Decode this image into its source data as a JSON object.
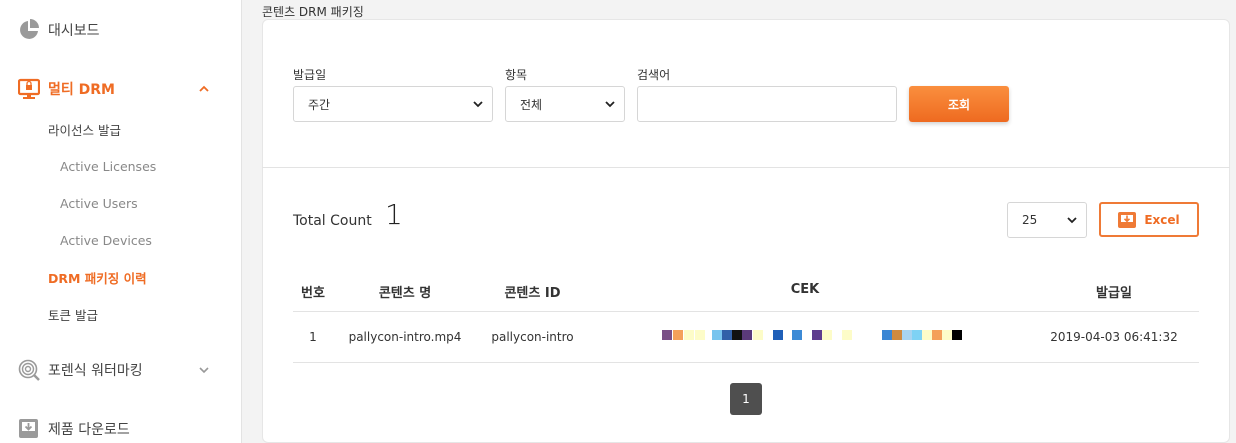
{
  "sidebar": {
    "dashboard": "대시보드",
    "multi_drm": "멀티 DRM",
    "license_issue": "라이선스 발급",
    "active_licenses": "Active Licenses",
    "active_users": "Active Users",
    "active_devices": "Active Devices",
    "drm_packaging_history": "DRM 패키징 이력",
    "token_issue": "토큰 발급",
    "forensic_watermark": "포렌식 워터마킹",
    "product_download": "제품 다운로드"
  },
  "page": {
    "title": "콘텐츠 DRM 패키징"
  },
  "filters": {
    "date_label": "발급일",
    "date_value": "주간",
    "item_label": "항목",
    "item_value": "전체",
    "search_label": "검색어",
    "search_value": "",
    "search_button": "조회"
  },
  "summary": {
    "total_label": "Total Count",
    "total_value": "1",
    "page_size": "25",
    "excel_button": "Excel"
  },
  "table": {
    "headers": [
      "번호",
      "콘텐츠 명",
      "콘텐츠 ID",
      "CEK",
      "발급일"
    ],
    "rows": [
      {
        "no": "1",
        "content_name": "pallycon-intro.mp4",
        "content_id": "pallycon-intro",
        "cek_colors": [
          "#7a4f86",
          "#f4a05a",
          "#fdfcc8",
          "#fdfcc8",
          "#78c4ee",
          "#3160a8",
          "#111111",
          "#5a3a7a",
          "#fdfcc8",
          "#1f5fb8",
          "#3c8ad6",
          "#5e3c8e",
          "#fdfcc8",
          "#fdfcc8",
          "#3a86d4",
          "#cf8a40",
          "#a8d4f0",
          "#7ed2f4",
          "#fdfcc8",
          "#f4a05a",
          "#fdfcc8",
          "#000000"
        ],
        "issued": "2019-04-03 06:41:32"
      }
    ]
  },
  "pagination": {
    "current": "1"
  },
  "colors": {
    "accent": "#ef6c24",
    "pagination": "#4f4f4f"
  }
}
